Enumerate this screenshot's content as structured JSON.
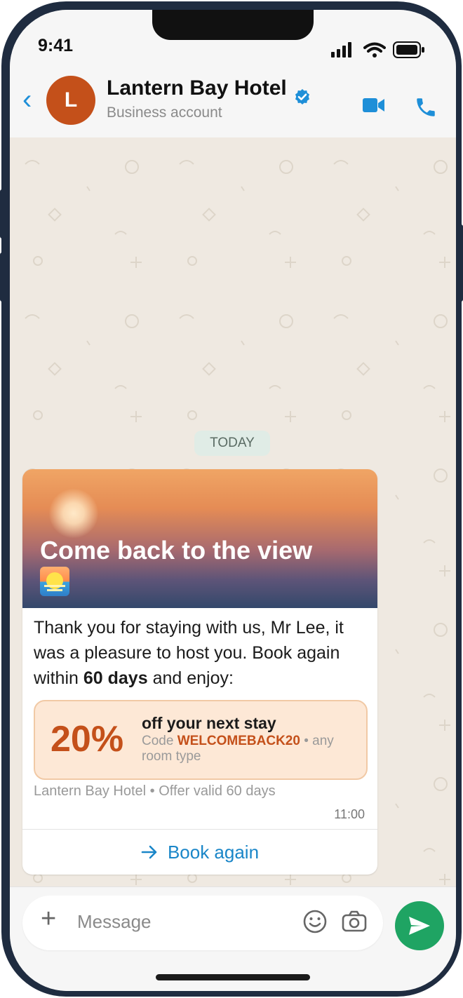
{
  "status_bar": {
    "time": "9:41"
  },
  "header": {
    "back_icon": "chevron-left-icon",
    "avatar_initial": "L",
    "contact_name": "Lantern Bay Hotel",
    "verified_icon": "verified-badge-icon",
    "subtitle": "Business account",
    "video_icon": "video-camera-icon",
    "call_icon": "phone-icon"
  },
  "chat": {
    "date_separator": "TODAY",
    "message": {
      "hero_title": "Come back to the view",
      "hero_emoji": "sunrise-emoji",
      "body": {
        "part1": "Thank you for staying with us, Mr Lee, it was a pleasure to host you. Book again within ",
        "bold": "60 days",
        "part2": " and enjoy:"
      },
      "offer": {
        "percent": "20%",
        "title": "off your next stay",
        "code_prefix": "Code ",
        "code": "WELCOMEBACK20",
        "code_suffix": " • any room type"
      },
      "footer": "Lantern Bay Hotel • Offer valid 60 days",
      "time": "11:00",
      "button_label": "Book again",
      "button_icon": "arrow-right-icon"
    }
  },
  "composer": {
    "placeholder": "Message",
    "plus_icon": "plus-icon",
    "emoji_icon": "smiley-icon",
    "camera_icon": "camera-icon",
    "send_icon": "send-icon"
  },
  "colors": {
    "accent_blue": "#1e8fd8",
    "brand_orange": "#c4501a",
    "send_green": "#1fa463",
    "chat_background": "#efe9e1"
  }
}
